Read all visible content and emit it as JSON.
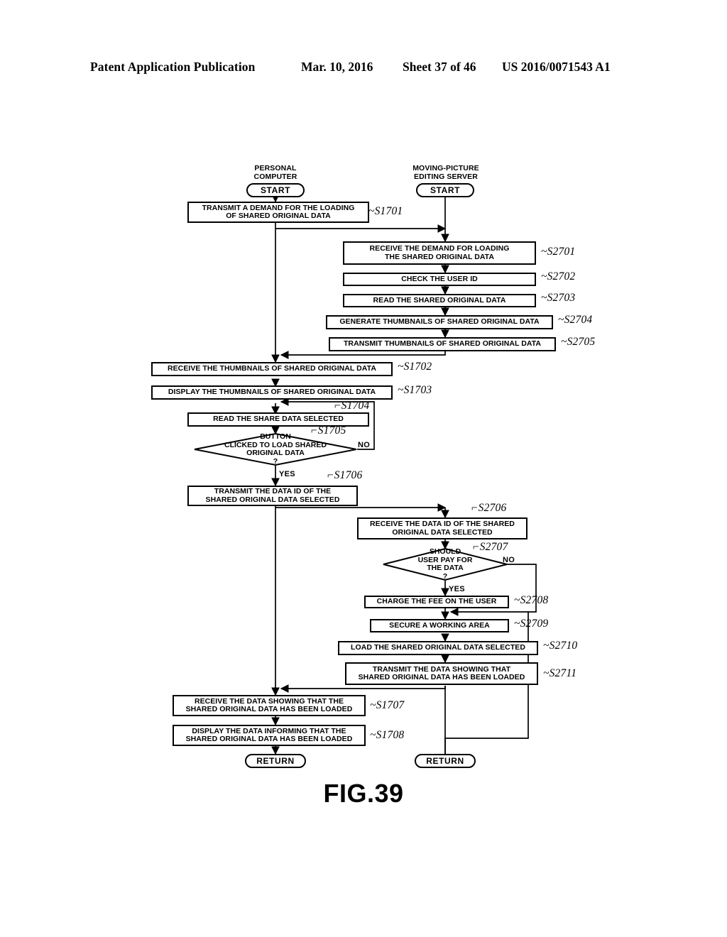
{
  "header": {
    "title": "Patent Application Publication",
    "date": "Mar. 10, 2016",
    "sheet": "Sheet 37 of 46",
    "publication_number": "US 2016/0071543 A1"
  },
  "figure": {
    "caption": "FIG.39",
    "lanes": [
      {
        "id": "pc",
        "caption": "PERSONAL\nCOMPUTER"
      },
      {
        "id": "server",
        "caption": "MOVING-PICTURE\nEDITING SERVER"
      }
    ],
    "terminators": {
      "pc_start": "START",
      "server_start": "START",
      "pc_return": "RETURN",
      "server_return": "RETURN"
    },
    "branch_labels": {
      "s1705_no": "NO",
      "s1705_yes": "YES",
      "s2707_no": "NO",
      "s2707_yes": "YES"
    },
    "steps": [
      {
        "ref": "S1701",
        "lane": "pc",
        "type": "process",
        "text": "TRANSMIT A DEMAND FOR THE LOADING\nOF SHARED ORIGINAL DATA"
      },
      {
        "ref": "S2701",
        "lane": "server",
        "type": "process",
        "text": "RECEIVE THE DEMAND FOR LOADING\nTHE SHARED ORIGINAL DATA"
      },
      {
        "ref": "S2702",
        "lane": "server",
        "type": "process",
        "text": "CHECK THE USER ID"
      },
      {
        "ref": "S2703",
        "lane": "server",
        "type": "process",
        "text": "READ THE SHARED ORIGINAL DATA"
      },
      {
        "ref": "S2704",
        "lane": "server",
        "type": "process",
        "text": "GENERATE THUMBNAILS OF SHARED ORIGINAL DATA"
      },
      {
        "ref": "S2705",
        "lane": "server",
        "type": "process",
        "text": "TRANSMIT THUMBNAILS OF SHARED ORIGINAL DATA"
      },
      {
        "ref": "S1702",
        "lane": "pc",
        "type": "process",
        "text": "RECEIVE THE THUMBNAILS OF SHARED ORIGINAL DATA"
      },
      {
        "ref": "S1703",
        "lane": "pc",
        "type": "process",
        "text": "DISPLAY THE THUMBNAILS OF SHARED ORIGINAL DATA"
      },
      {
        "ref": "S1704",
        "lane": "pc",
        "type": "process",
        "text": "READ THE SHARE DATA SELECTED"
      },
      {
        "ref": "S1705",
        "lane": "pc",
        "type": "decision",
        "text": "BUTTON\nCLICKED TO LOAD SHARED\nORIGINAL DATA\n?"
      },
      {
        "ref": "S1706",
        "lane": "pc",
        "type": "process",
        "text": "TRANSMIT THE DATA ID OF THE\nSHARED ORIGINAL DATA SELECTED"
      },
      {
        "ref": "S2706",
        "lane": "server",
        "type": "process",
        "text": "RECEIVE THE DATA ID OF THE SHARED\nORIGINAL DATA SELECTED"
      },
      {
        "ref": "S2707",
        "lane": "server",
        "type": "decision",
        "text": "SHOULD\nUSER PAY FOR\nTHE DATA\n?"
      },
      {
        "ref": "S2708",
        "lane": "server",
        "type": "process",
        "text": "CHARGE THE FEE ON THE USER"
      },
      {
        "ref": "S2709",
        "lane": "server",
        "type": "process",
        "text": "SECURE A WORKING AREA"
      },
      {
        "ref": "S2710",
        "lane": "server",
        "type": "process",
        "text": "LOAD THE SHARED ORIGINAL DATA SELECTED"
      },
      {
        "ref": "S2711",
        "lane": "server",
        "type": "process",
        "text": "TRANSMIT THE DATA SHOWING THAT\nSHARED ORIGINAL DATA HAS BEEN LOADED"
      },
      {
        "ref": "S1707",
        "lane": "pc",
        "type": "process",
        "text": "RECEIVE THE DATA SHOWING THAT THE\nSHARED ORIGINAL DATA HAS BEEN LOADED"
      },
      {
        "ref": "S1708",
        "lane": "pc",
        "type": "process",
        "text": "DISPLAY THE DATA INFORMING THAT THE\nSHARED ORIGINAL DATA HAS BEEN LOADED"
      }
    ]
  }
}
